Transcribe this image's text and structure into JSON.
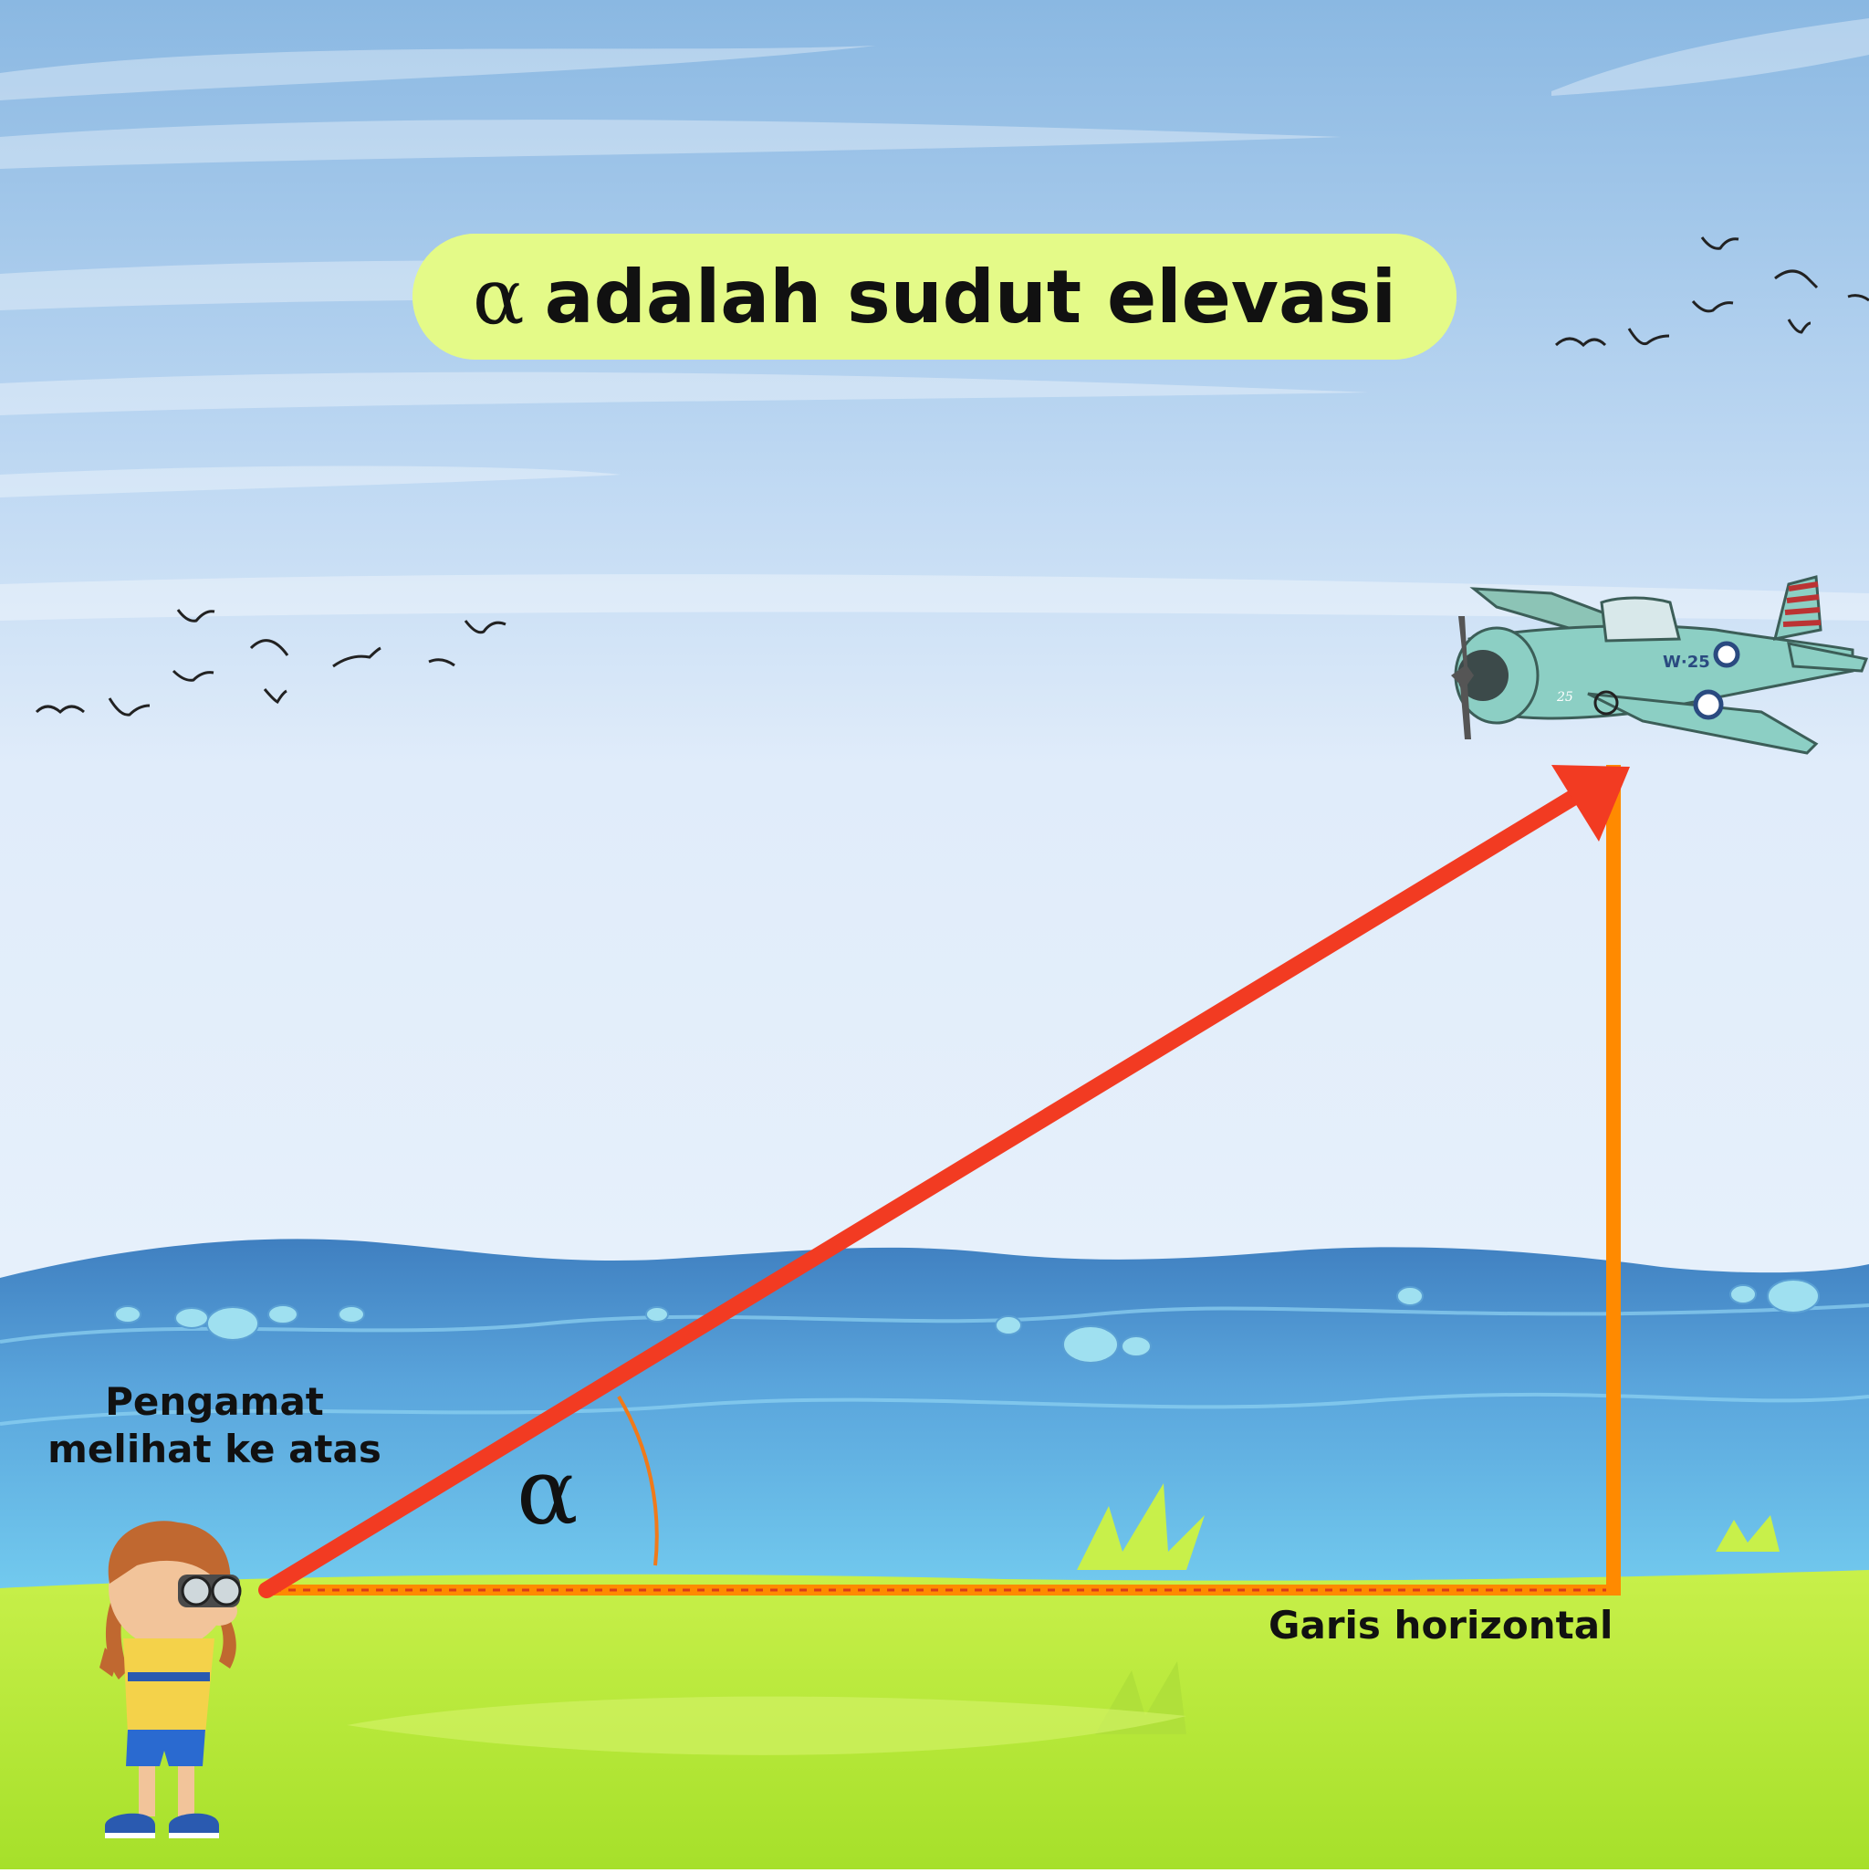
{
  "title": {
    "symbol": "α",
    "text": "adalah sudut elevasi"
  },
  "labels": {
    "observer_line1": "Pengamat",
    "observer_line2": "melihat ke atas",
    "horizontal": "Garis horizontal",
    "angle": "α"
  },
  "airplane": {
    "marking": "W·25",
    "number": "25"
  },
  "colors": {
    "line_of_sight": "#f23b22",
    "vertical_line": "#ff8a00",
    "horizontal_line": "#ff8a00",
    "title_background": "#e4fa88",
    "sky": "#a9cbea",
    "sea": "#4f9bd6",
    "grass": "#b5e83a"
  },
  "icons": [
    "bird-icon",
    "airplane-icon",
    "girl-with-binoculars-icon"
  ]
}
